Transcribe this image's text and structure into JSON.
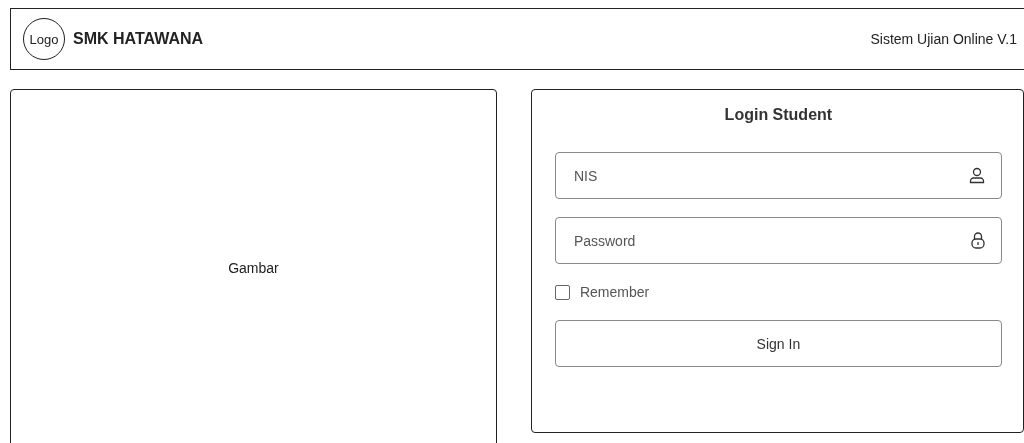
{
  "header": {
    "logo": "Logo",
    "school": "SMK HATAWANA",
    "system": "Sistem Ujian Online V.1"
  },
  "image_panel": {
    "label": "Gambar"
  },
  "login": {
    "title": "Login Student",
    "fields": [
      {
        "placeholder": "NIS",
        "kind": "user"
      },
      {
        "placeholder": "Password",
        "kind": "lock"
      }
    ],
    "remember": {
      "label": "Remember",
      "checked": false
    },
    "button": "Sign In"
  }
}
